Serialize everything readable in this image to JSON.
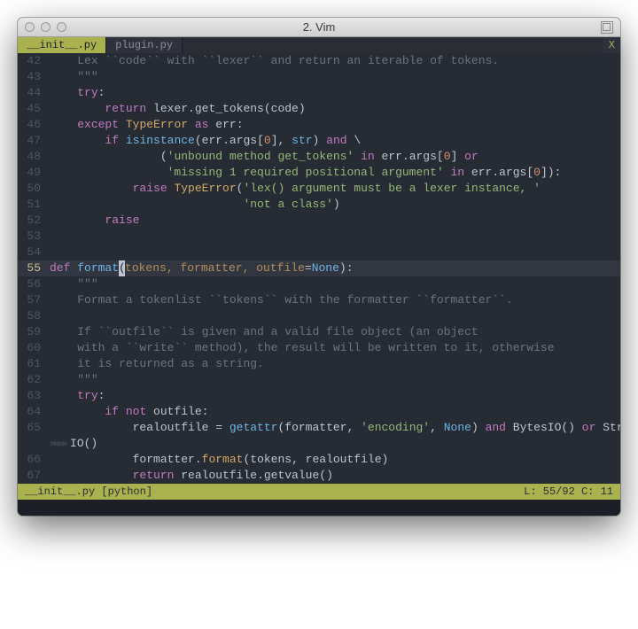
{
  "window": {
    "title": "2. Vim"
  },
  "tabs": [
    {
      "label": "__init__.py",
      "active": true
    },
    {
      "label": "plugin.py",
      "active": false
    }
  ],
  "tab_close": "X",
  "status": {
    "file": "__init__.py",
    "filetype": "[python]",
    "line": 55,
    "total_lines": 92,
    "col": 11
  },
  "cursor": {
    "line": 55,
    "col": 11
  },
  "lines": [
    {
      "n": 42,
      "kind": "comment",
      "indent": "    ",
      "text": "Lex ``code`` with ``lexer`` and return an iterable of tokens."
    },
    {
      "n": 43,
      "kind": "comment",
      "indent": "    ",
      "text": "\"\"\""
    },
    {
      "n": 44,
      "kind": "code",
      "indent": "    ",
      "tokens": [
        [
          "kw",
          "try"
        ],
        [
          "punc",
          ":"
        ]
      ]
    },
    {
      "n": 45,
      "kind": "code",
      "indent": "        ",
      "tokens": [
        [
          "kw",
          "return"
        ],
        [
          "text",
          " lexer.get_tokens(code)"
        ]
      ]
    },
    {
      "n": 46,
      "kind": "code",
      "indent": "    ",
      "tokens": [
        [
          "kw",
          "except"
        ],
        [
          "text",
          " "
        ],
        [
          "type",
          "TypeError"
        ],
        [
          "text",
          " "
        ],
        [
          "kw",
          "as"
        ],
        [
          "text",
          " err:"
        ]
      ]
    },
    {
      "n": 47,
      "kind": "code",
      "indent": "        ",
      "tokens": [
        [
          "kw",
          "if"
        ],
        [
          "text",
          " "
        ],
        [
          "builtin",
          "isinstance"
        ],
        [
          "punc",
          "("
        ],
        [
          "text",
          "err.args["
        ],
        [
          "num",
          "0"
        ],
        [
          "text",
          "], "
        ],
        [
          "builtin",
          "str"
        ],
        [
          "punc",
          ")"
        ],
        [
          "text",
          " "
        ],
        [
          "kw",
          "and"
        ],
        [
          "text",
          " \\"
        ]
      ]
    },
    {
      "n": 48,
      "kind": "code",
      "indent": "                ",
      "tokens": [
        [
          "punc",
          "("
        ],
        [
          "str",
          "'unbound method get_tokens'"
        ],
        [
          "text",
          " "
        ],
        [
          "kw",
          "in"
        ],
        [
          "text",
          " err.args["
        ],
        [
          "num",
          "0"
        ],
        [
          "text",
          "] "
        ],
        [
          "kw",
          "or"
        ]
      ]
    },
    {
      "n": 49,
      "kind": "code",
      "indent": "                 ",
      "tokens": [
        [
          "str",
          "'missing 1 required positional argument'"
        ],
        [
          "text",
          " "
        ],
        [
          "kw",
          "in"
        ],
        [
          "text",
          " err.args["
        ],
        [
          "num",
          "0"
        ],
        [
          "text",
          "]):"
        ]
      ]
    },
    {
      "n": 50,
      "kind": "code",
      "indent": "            ",
      "tokens": [
        [
          "kw",
          "raise"
        ],
        [
          "text",
          " "
        ],
        [
          "type",
          "TypeError"
        ],
        [
          "punc",
          "("
        ],
        [
          "str",
          "'lex() argument must be a lexer instance, '"
        ]
      ]
    },
    {
      "n": 51,
      "kind": "code",
      "indent": "                            ",
      "tokens": [
        [
          "str",
          "'not a class'"
        ],
        [
          "punc",
          ")"
        ]
      ]
    },
    {
      "n": 52,
      "kind": "code",
      "indent": "        ",
      "tokens": [
        [
          "kw",
          "raise"
        ]
      ]
    },
    {
      "n": 53,
      "kind": "blank"
    },
    {
      "n": 54,
      "kind": "blank"
    },
    {
      "n": 55,
      "kind": "code",
      "current": true,
      "indent": "",
      "tokens": [
        [
          "kw",
          "def"
        ],
        [
          "text",
          " "
        ],
        [
          "def",
          "format"
        ],
        [
          "cursor",
          "("
        ],
        [
          "param",
          "tokens, formatter, outfile"
        ],
        [
          "punc",
          "="
        ],
        [
          "builtin",
          "None"
        ],
        [
          "punc",
          "):"
        ]
      ]
    },
    {
      "n": 56,
      "kind": "comment",
      "indent": "    ",
      "text": "\"\"\""
    },
    {
      "n": 57,
      "kind": "comment",
      "indent": "    ",
      "text": "Format a tokenlist ``tokens`` with the formatter ``formatter``."
    },
    {
      "n": 58,
      "kind": "blank-comment"
    },
    {
      "n": 59,
      "kind": "comment",
      "indent": "    ",
      "text": "If ``outfile`` is given and a valid file object (an object"
    },
    {
      "n": 60,
      "kind": "comment",
      "indent": "    ",
      "text": "with a ``write`` method), the result will be written to it, otherwise"
    },
    {
      "n": 61,
      "kind": "comment",
      "indent": "    ",
      "text": "it is returned as a string."
    },
    {
      "n": 62,
      "kind": "comment",
      "indent": "    ",
      "text": "\"\"\""
    },
    {
      "n": 63,
      "kind": "code",
      "indent": "    ",
      "tokens": [
        [
          "kw",
          "try"
        ],
        [
          "punc",
          ":"
        ]
      ]
    },
    {
      "n": 64,
      "kind": "code",
      "indent": "        ",
      "tokens": [
        [
          "kw",
          "if"
        ],
        [
          "text",
          " "
        ],
        [
          "kw",
          "not"
        ],
        [
          "text",
          " outfile:"
        ]
      ]
    },
    {
      "n": 65,
      "kind": "code",
      "indent": "            ",
      "tokens": [
        [
          "text",
          "realoutfile = "
        ],
        [
          "builtin",
          "getattr"
        ],
        [
          "punc",
          "("
        ],
        [
          "text",
          "formatter, "
        ],
        [
          "str",
          "'encoding'"
        ],
        [
          "text",
          ", "
        ],
        [
          "builtin",
          "None"
        ],
        [
          "punc",
          ")"
        ],
        [
          "text",
          " "
        ],
        [
          "kw",
          "and"
        ],
        [
          "text",
          " BytesIO() "
        ],
        [
          "kw",
          "or"
        ],
        [
          "text",
          " String"
        ]
      ]
    },
    {
      "n": "",
      "kind": "wrap",
      "fold": "»»»» ",
      "tokens": [
        [
          "text",
          "IO()"
        ]
      ]
    },
    {
      "n": 66,
      "kind": "code",
      "indent": "            ",
      "tokens": [
        [
          "text",
          "formatter."
        ],
        [
          "func",
          "format"
        ],
        [
          "punc",
          "("
        ],
        [
          "text",
          "tokens, realoutfile"
        ],
        [
          "punc",
          ")"
        ]
      ]
    },
    {
      "n": 67,
      "kind": "code",
      "indent": "            ",
      "tokens": [
        [
          "kw",
          "return"
        ],
        [
          "text",
          " realoutfile.getvalue()"
        ]
      ]
    }
  ]
}
